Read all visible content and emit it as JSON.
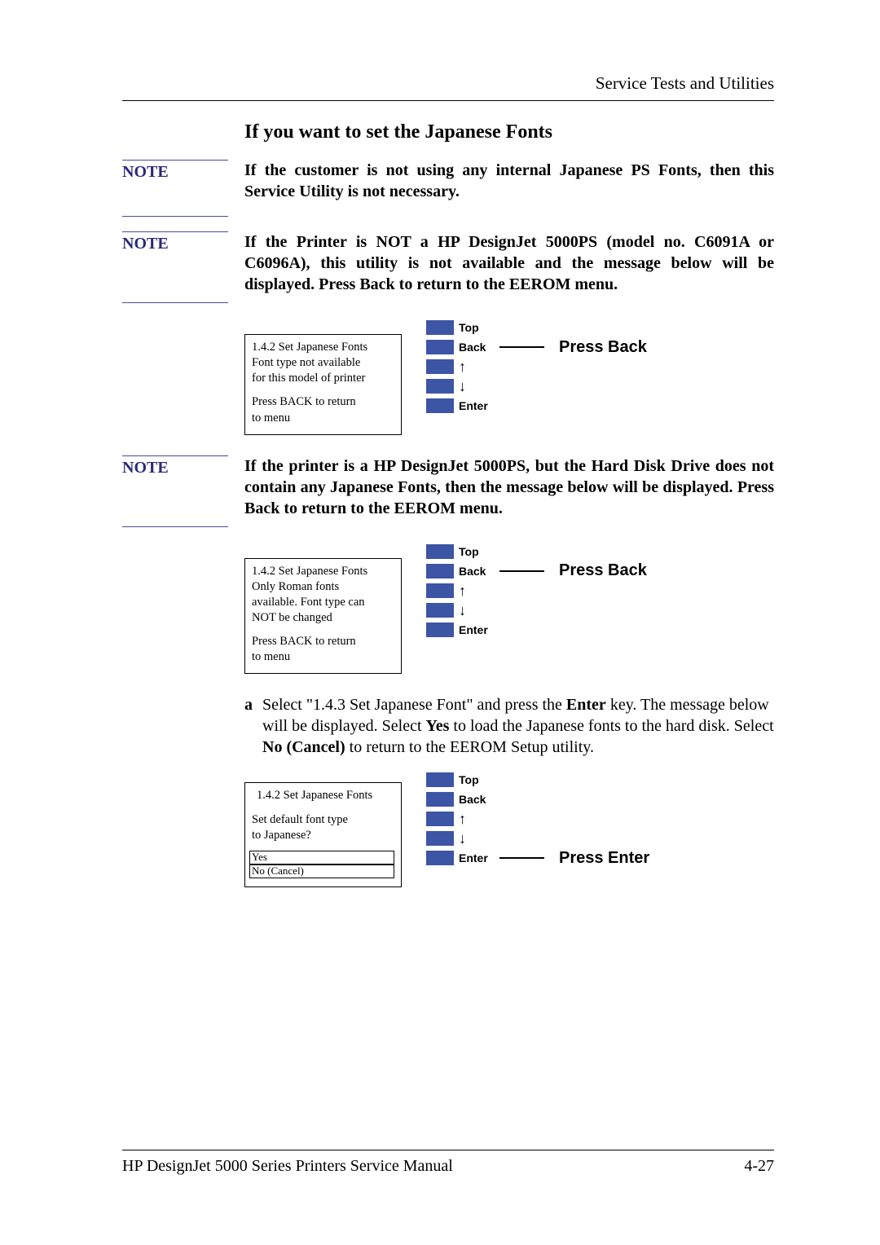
{
  "header": {
    "running_head": "Service Tests and Utilities"
  },
  "section_title": "If you want to set the Japanese Fonts",
  "notes": {
    "label": "NOTE",
    "n1": "If the customer is not using any internal Japanese PS Fonts, then this Service Utility is not necessary.",
    "n2": "If the Printer is NOT a HP DesignJet 5000PS (model no. C6091A or C6096A), this utility is not available and the message below will be displayed. Press Back to return to the EEROM menu.",
    "n3": "If the printer is a HP DesignJet 5000PS, but the Hard Disk Drive does not contain any Japanese Fonts, then the message below will be displayed. Press Back to return to the EEROM menu."
  },
  "lcd1": {
    "l1": "1.4.2 Set Japanese Fonts",
    "l2": "Font type not available",
    "l3": "for this model of printer",
    "l4": "Press BACK to return",
    "l5": "to menu"
  },
  "lcd2": {
    "l1": "1.4.2 Set Japanese Fonts",
    "l2": "Only Roman fonts",
    "l3": "available. Font type can",
    "l4": "NOT be changed",
    "l5": "Press BACK to return",
    "l6": "to menu"
  },
  "lcd3": {
    "l1": "1.4.2 Set Japanese Fonts",
    "l2": "Set default font type",
    "l3": "to Japanese?",
    "opt1": "Yes",
    "opt2": "No (Cancel)"
  },
  "keypad": {
    "top": "Top",
    "back": "Back",
    "up": "↑",
    "down": "↓",
    "enter": "Enter"
  },
  "callouts": {
    "press_back": "Press Back",
    "press_enter": "Press Enter"
  },
  "step_a": {
    "label": "a",
    "t1": "Select \"1.4.3 Set Japanese Font\" and press the ",
    "b1": "Enter",
    "t2": " key. The message below will be displayed. Select ",
    "b2": "Yes",
    "t3": " to load the Japanese fonts to the hard disk. Select ",
    "b3": "No (Cancel)",
    "t4": " to return to the EEROM Setup utility."
  },
  "footer": {
    "left": "HP DesignJet 5000 Series Printers Service Manual",
    "right": "4-27"
  }
}
